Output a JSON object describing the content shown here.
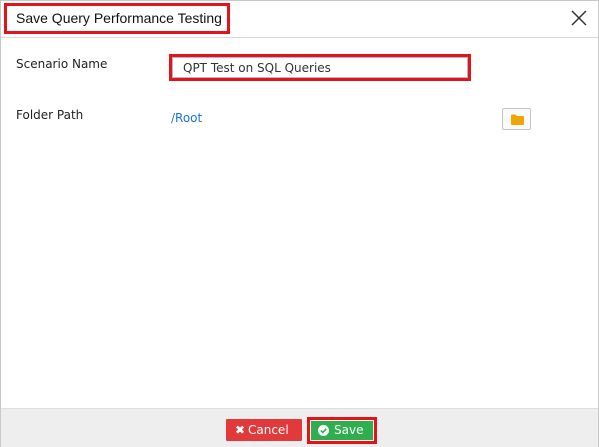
{
  "dialog": {
    "title": "Save Query Performance Testing",
    "close_icon": "close-icon"
  },
  "form": {
    "scenario_label": "Scenario Name",
    "scenario_value": "QPT Test on SQL Queries",
    "folder_label": "Folder Path",
    "folder_value": "/Root",
    "folder_icon": "folder-icon"
  },
  "footer": {
    "cancel_label": "Cancel",
    "save_label": "Save",
    "cancel_color": "#e23a3a",
    "save_color": "#2fae4f"
  },
  "colors": {
    "highlight": "#e3131b",
    "link": "#1a74d6",
    "folder_icon": "#f0a500"
  }
}
